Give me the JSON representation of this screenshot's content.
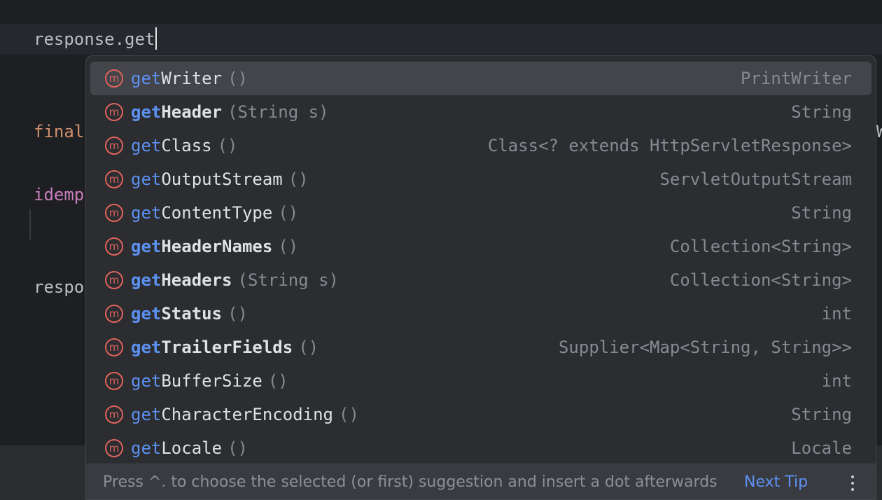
{
  "editor": {
    "line1": "response.get",
    "line2": "final",
    "line3": "idemp",
    "line4": "respo",
    "edge_glyph": "W"
  },
  "completion": {
    "items": [
      {
        "prefix": "get",
        "rest": "Writer",
        "params": "()",
        "type": "PrintWriter",
        "bold": false,
        "selected": true,
        "icon": "method-icon"
      },
      {
        "prefix": "get",
        "rest": "Header",
        "params": "(String s)",
        "type": "String",
        "bold": true,
        "selected": false,
        "icon": "method-icon"
      },
      {
        "prefix": "get",
        "rest": "Class",
        "params": "()",
        "type": "Class<? extends HttpServletResponse>",
        "bold": false,
        "selected": false,
        "icon": "method-icon"
      },
      {
        "prefix": "get",
        "rest": "OutputStream",
        "params": "()",
        "type": "ServletOutputStream",
        "bold": false,
        "selected": false,
        "icon": "method-icon"
      },
      {
        "prefix": "get",
        "rest": "ContentType",
        "params": "()",
        "type": "String",
        "bold": false,
        "selected": false,
        "icon": "method-icon"
      },
      {
        "prefix": "get",
        "rest": "HeaderNames",
        "params": "()",
        "type": "Collection<String>",
        "bold": true,
        "selected": false,
        "icon": "method-icon"
      },
      {
        "prefix": "get",
        "rest": "Headers",
        "params": "(String s)",
        "type": "Collection<String>",
        "bold": true,
        "selected": false,
        "icon": "method-icon"
      },
      {
        "prefix": "get",
        "rest": "Status",
        "params": "()",
        "type": "int",
        "bold": true,
        "selected": false,
        "icon": "method-icon"
      },
      {
        "prefix": "get",
        "rest": "TrailerFields",
        "params": "()",
        "type": "Supplier<Map<String, String>>",
        "bold": true,
        "selected": false,
        "icon": "method-icon"
      },
      {
        "prefix": "get",
        "rest": "BufferSize",
        "params": "()",
        "type": "int",
        "bold": false,
        "selected": false,
        "icon": "method-icon"
      },
      {
        "prefix": "get",
        "rest": "CharacterEncoding",
        "params": "()",
        "type": "String",
        "bold": false,
        "selected": false,
        "icon": "method-icon"
      },
      {
        "prefix": "get",
        "rest": "Locale",
        "params": "()",
        "type": "Locale",
        "bold": false,
        "selected": false,
        "icon": "method-icon"
      }
    ],
    "footer": {
      "hint": "Press ^. to choose the selected (or first) suggestion and insert a dot afterwards",
      "next_tip": "Next Tip",
      "more_icon": "vertical-ellipsis-icon"
    }
  },
  "colors": {
    "editor_bg": "#1e1f22",
    "popup_bg": "#2b2d30",
    "selected_bg": "#43454a",
    "match_highlight": "#5c91f2",
    "method_icon": "#e0635c"
  }
}
